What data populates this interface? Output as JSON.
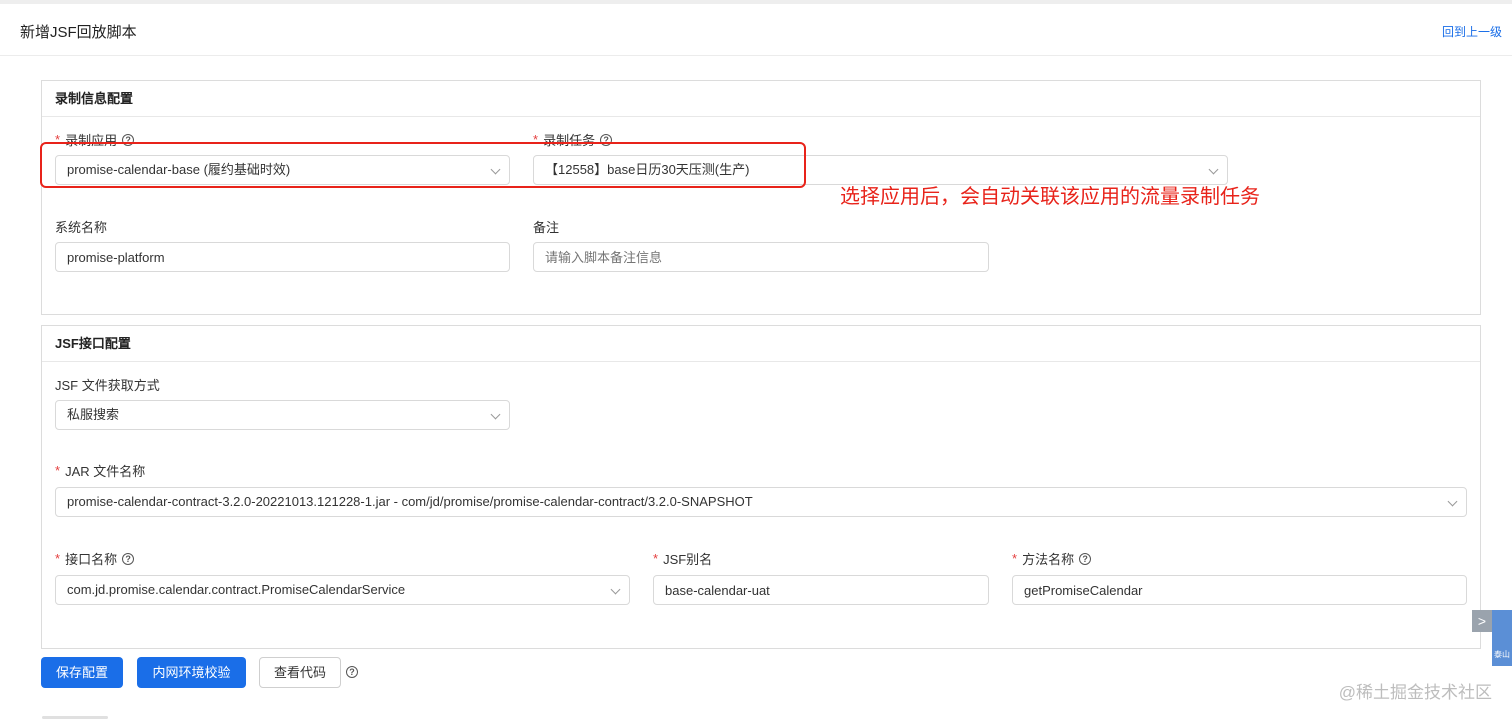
{
  "header": {
    "title": "新增JSF回放脚本",
    "back_link": "回到上一级"
  },
  "record_section": {
    "title": "录制信息配置",
    "app_label": "录制应用",
    "app_value": "promise-calendar-base (履约基础时效)",
    "task_label": "录制任务",
    "task_value": "【12558】base日历30天压测(生产)",
    "system_label": "系统名称",
    "system_value": "promise-platform",
    "remark_label": "备注",
    "remark_placeholder": "请输入脚本备注信息"
  },
  "annotation": "选择应用后，会自动关联该应用的流量录制任务",
  "jsf_section": {
    "title": "JSF接口配置",
    "fetch_label": "JSF 文件获取方式",
    "fetch_value": "私服搜索",
    "jar_label": "JAR 文件名称",
    "jar_value": "promise-calendar-contract-3.2.0-20221013.121228-1.jar - com/jd/promise/promise-calendar-contract/3.2.0-SNAPSHOT",
    "interface_label": "接口名称",
    "interface_value": "com.jd.promise.calendar.contract.PromiseCalendarService",
    "alias_label": "JSF别名",
    "alias_value": "base-calendar-uat",
    "method_label": "方法名称",
    "method_value": "getPromiseCalendar"
  },
  "buttons": {
    "save": "保存配置",
    "verify": "内网环境校验",
    "view_code": "查看代码"
  },
  "common": {
    "required_mark": "*",
    "help_glyph": "?"
  },
  "side_widget": {
    "arrow": ">",
    "avatar_text": "泰山"
  },
  "watermark": "@稀土掘金技术社区",
  "colors": {
    "primary": "#1a6ee8",
    "annotation_red": "#e8231a",
    "required_red": "#e53e3e"
  }
}
